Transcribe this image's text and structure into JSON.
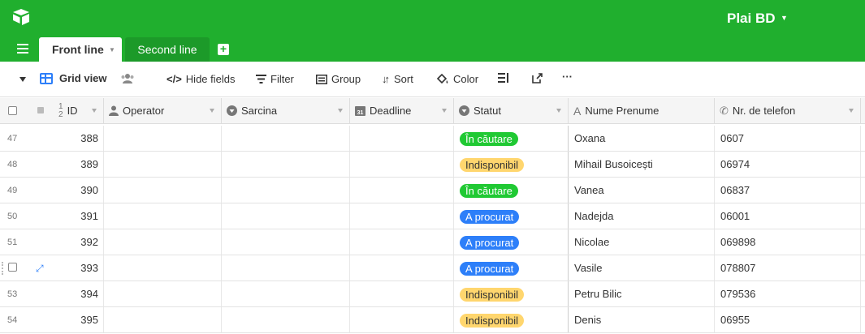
{
  "header": {
    "base_title": "Plai BD",
    "tabs": [
      {
        "label": "Front line",
        "active": true
      },
      {
        "label": "Second line",
        "active": false
      }
    ]
  },
  "toolbar": {
    "view_name": "Grid view",
    "hide_fields": "Hide fields",
    "filter": "Filter",
    "group": "Group",
    "sort": "Sort",
    "color": "Color",
    "more": "···"
  },
  "columns": [
    {
      "label": "ID",
      "icon": "number-icon"
    },
    {
      "label": "Operator",
      "icon": "user-icon"
    },
    {
      "label": "Sarcina",
      "icon": "single-select-icon"
    },
    {
      "label": "Deadline",
      "icon": "calendar-icon"
    },
    {
      "label": "Statut",
      "icon": "single-select-icon"
    },
    {
      "label": "Nume Prenume",
      "icon": "text-icon"
    },
    {
      "label": "Nr. de telefon",
      "icon": "phone-icon"
    }
  ],
  "status_colors": {
    "În căutare": {
      "bg": "#20c933",
      "fg": "#ffffff"
    },
    "Indisponibil": {
      "bg": "#ffd66e",
      "fg": "#333333"
    },
    "A procurat": {
      "bg": "#2d7ff9",
      "fg": "#ffffff"
    }
  },
  "rows": [
    {
      "num": "47",
      "id": "388",
      "status": "În căutare",
      "name": "Oxana",
      "phone": "0607"
    },
    {
      "num": "48",
      "id": "389",
      "status": "Indisponibil",
      "name": "Mihail Busoicești",
      "phone": "06974"
    },
    {
      "num": "49",
      "id": "390",
      "status": "În căutare",
      "name": "Vanea",
      "phone": "06837"
    },
    {
      "num": "50",
      "id": "391",
      "status": "A procurat",
      "name": "Nadejda",
      "phone": "06001"
    },
    {
      "num": "51",
      "id": "392",
      "status": "A procurat",
      "name": "Nicolae",
      "phone": "069898"
    },
    {
      "num": "",
      "id": "393",
      "status": "A procurat",
      "name": "Vasile",
      "phone": "078807",
      "hovered": true
    },
    {
      "num": "53",
      "id": "394",
      "status": "Indisponibil",
      "name": "Petru Bilic",
      "phone": "079536"
    },
    {
      "num": "54",
      "id": "395",
      "status": "Indisponibil",
      "name": "Denis",
      "phone": "06955"
    }
  ]
}
